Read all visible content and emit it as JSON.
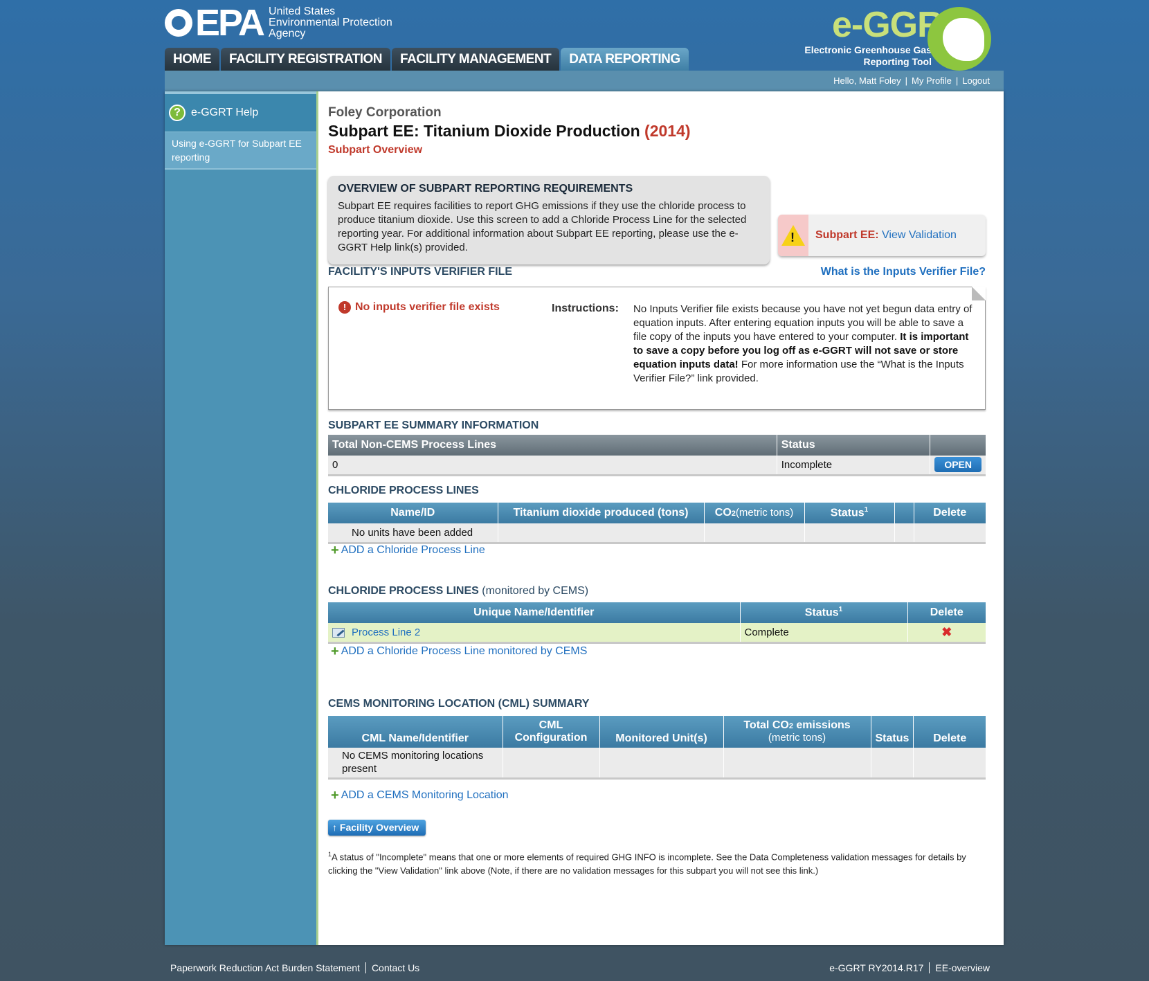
{
  "header": {
    "epa_mark": "EPA",
    "agency_line1": "United States",
    "agency_line2": "Environmental Protection",
    "agency_line3": "Agency",
    "ggrt_title": "e-GGRT",
    "ggrt_sub1": "Electronic Greenhouse Gas",
    "ggrt_sub2": "Reporting Tool"
  },
  "tabs": [
    {
      "label": "HOME"
    },
    {
      "label": "FACILITY REGISTRATION"
    },
    {
      "label": "FACILITY MANAGEMENT"
    },
    {
      "label": "DATA REPORTING"
    }
  ],
  "userbar": {
    "greeting": "Hello, Matt Foley",
    "profile": "My Profile",
    "logout": "Logout"
  },
  "sidebar": {
    "help_title": "e-GGRT Help",
    "help_link": "Using e-GGRT for Subpart EE reporting"
  },
  "page": {
    "company": "Foley Corporation",
    "title": "Subpart EE: Titanium Dioxide Production",
    "year": "(2014)",
    "subtitle": "Subpart Overview"
  },
  "overview": {
    "heading": "OVERVIEW OF SUBPART REPORTING REQUIREMENTS",
    "text": "Subpart EE requires facilities to report GHG emissions if they use the chloride process to produce titanium dioxide. Use this screen to add a Chloride Process Line for the selected reporting year. For additional information about Subpart EE reporting, please use the e-GGRT Help link(s) provided."
  },
  "validation": {
    "label": "Subpart EE:",
    "link": "View Validation"
  },
  "verifier": {
    "heading": "FACILITY'S INPUTS VERIFIER FILE",
    "what_link": "What is the Inputs Verifier File?",
    "status": "No inputs verifier file exists",
    "instr_label": "Instructions:",
    "instr_text1": "No Inputs Verifier file exists because you have not yet begun data entry of equation inputs.  After entering equation inputs you will be able to save a file copy of the inputs you have entered to your computer.  ",
    "instr_bold": "It is important to save a copy before you log off as e-GGRT will not save or store equation inputs data!",
    "instr_text2": " For more information use the “What is the Inputs Verifier File?” link provided."
  },
  "summary": {
    "heading": "SUBPART EE SUMMARY INFORMATION",
    "col1": "Total Non-CEMS Process Lines",
    "col2": "Status",
    "value": "0",
    "status": "Incomplete",
    "button": "OPEN"
  },
  "chloride": {
    "heading": "CHLORIDE PROCESS LINES",
    "cols": [
      "Name/ID",
      "Titanium dioxide produced (tons)",
      "CO",
      "Status",
      "Delete"
    ],
    "co2_sub": "2",
    "co2_unit": "(metric tons)",
    "status_sup": "1",
    "empty": "No units have been added",
    "add": "ADD a Chloride Process Line"
  },
  "chloride_cems": {
    "heading": "CHLORIDE PROCESS LINES",
    "heading_suffix": "(monitored by CEMS)",
    "cols": [
      "Unique Name/Identifier",
      "Status",
      "Delete"
    ],
    "status_sup": "1",
    "row_name": "Process Line 2",
    "row_status": "Complete",
    "add": "ADD a Chloride Process Line monitored by CEMS"
  },
  "cml": {
    "heading": "CEMS MONITORING LOCATION (CML) SUMMARY",
    "col_name": "CML Name/Identifier",
    "col_config": "CML Configuration",
    "col_units": "Monitored Unit(s)",
    "col_total": "Total CO",
    "col_total_sub": "2",
    "col_total_rest": " emissions",
    "col_total_unit": "(metric tons)",
    "col_status": "Status",
    "col_delete": "Delete",
    "empty": "No CEMS monitoring locations present",
    "add": "ADD a CEMS Monitoring Location"
  },
  "facility_button": "Facility Overview",
  "footnote": {
    "sup": "1",
    "text": "A status of \"Incomplete\" means that one or more elements of required GHG INFO is incomplete. See the Data Completeness validation messages for details by clicking the \"View Validation\" link above (Note, if there are no validation messages for this subpart you will not see this link.)"
  },
  "footer": {
    "paperwork": "Paperwork Reduction Act Burden Statement",
    "contact": "Contact Us",
    "version": "e-GGRT RY2014.R17",
    "page_id": "EE-overview"
  }
}
